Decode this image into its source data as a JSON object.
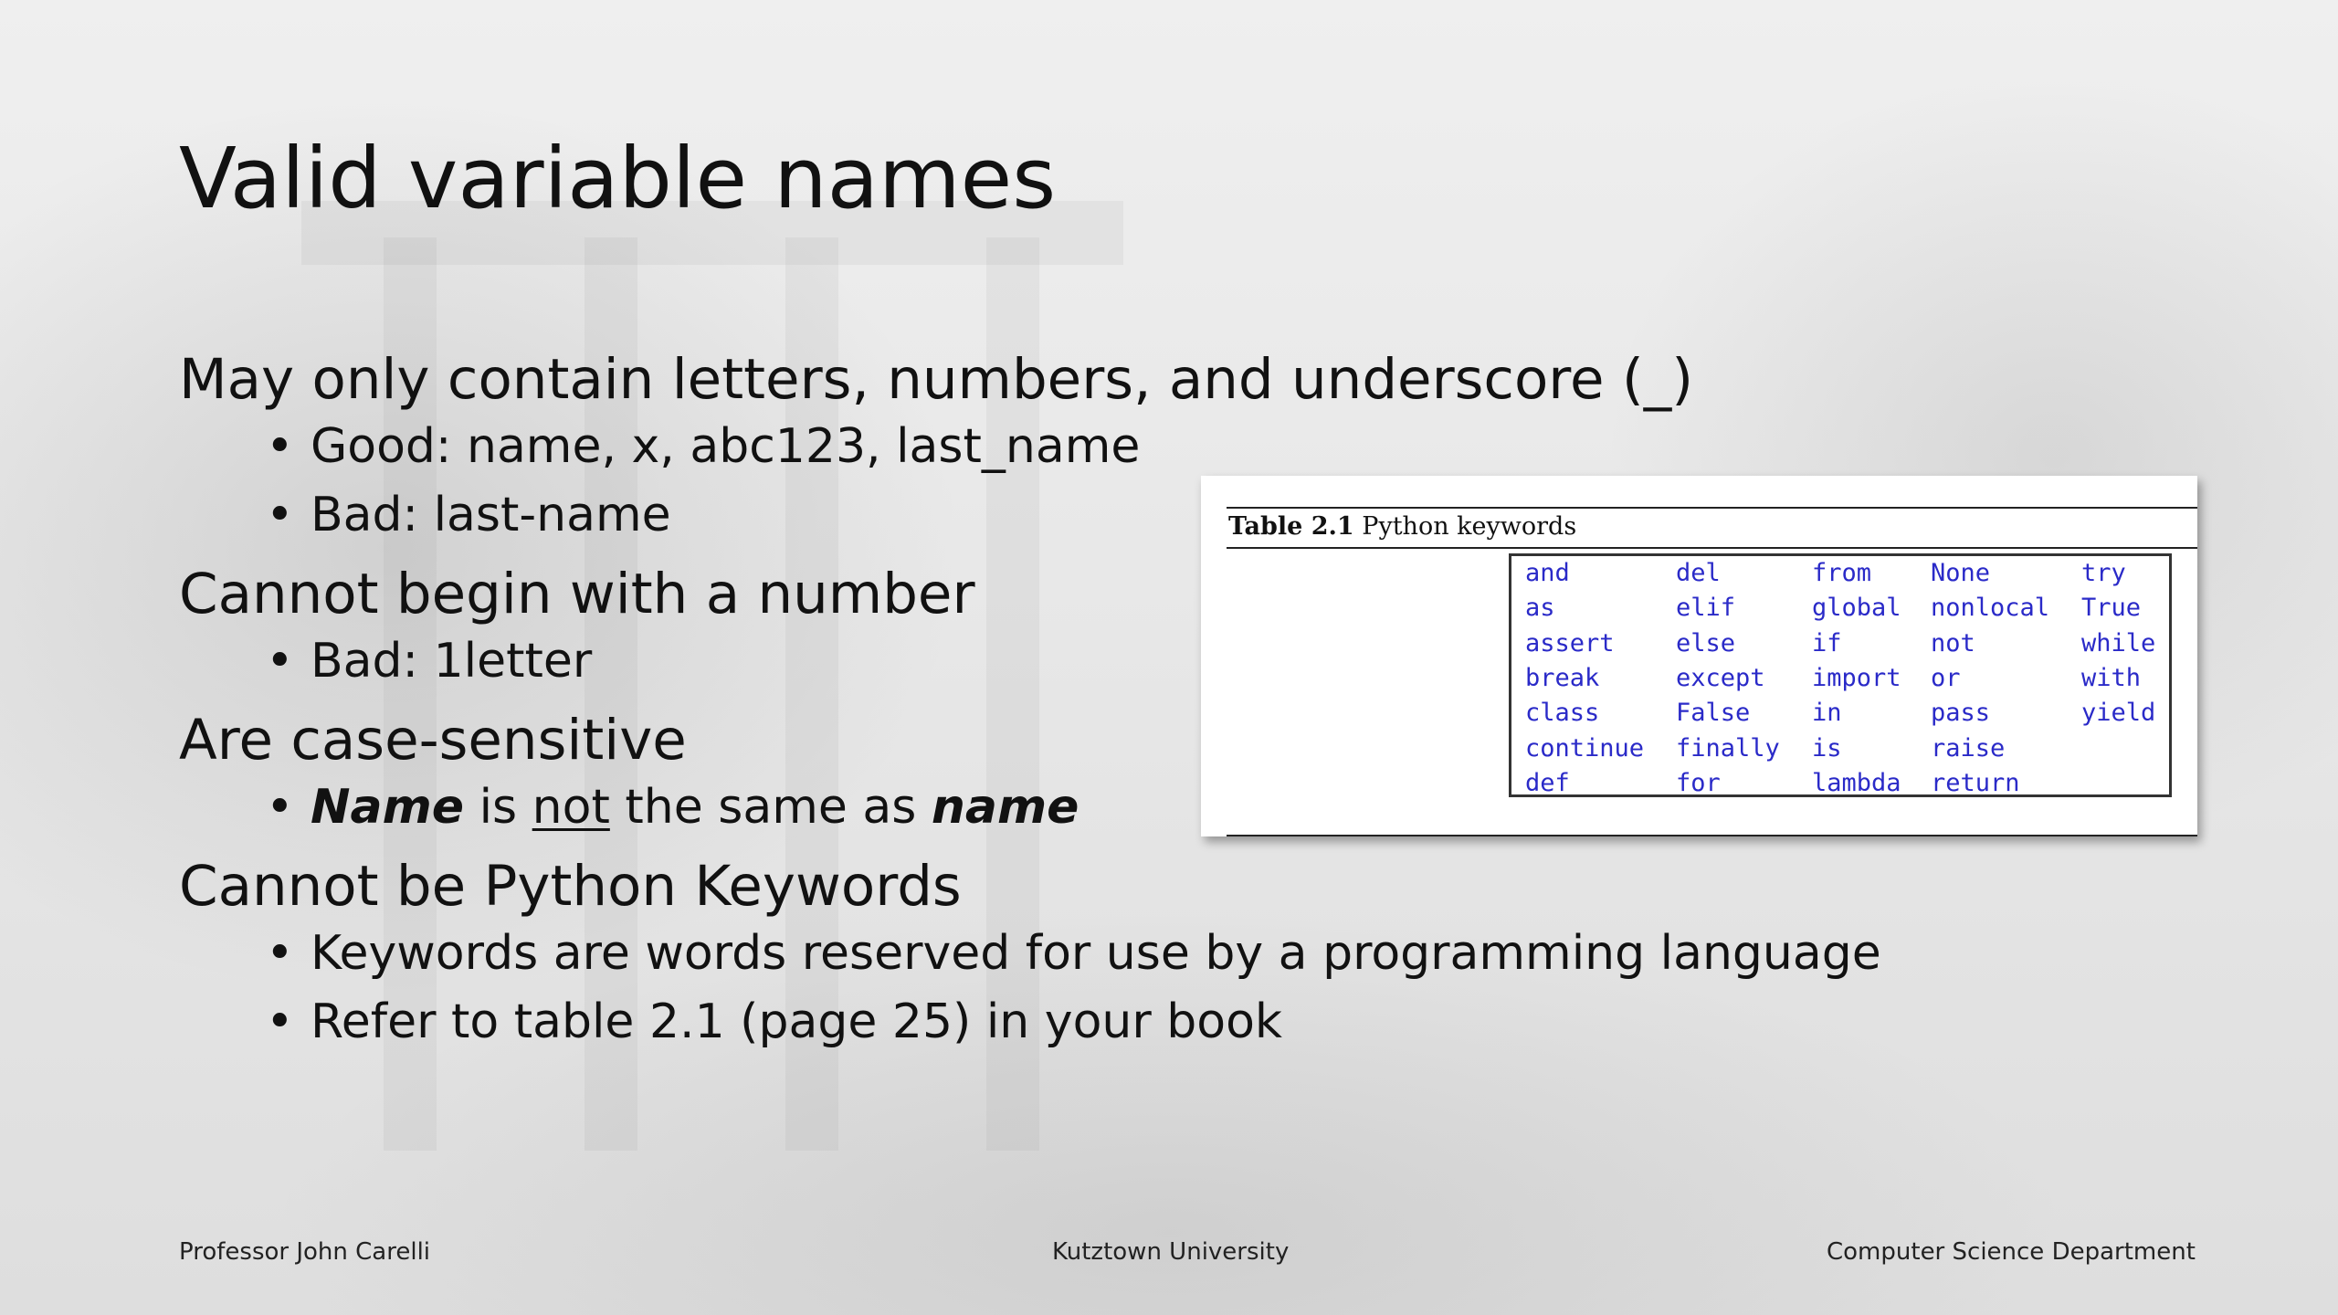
{
  "slide": {
    "title": "Valid variable names",
    "points": [
      {
        "text": "May only contain letters, numbers, and underscore (_)",
        "subs": [
          "Good: name, x, abc123, last_name",
          "Bad: last-name"
        ]
      },
      {
        "text": "Cannot begin with a number",
        "subs": [
          "Bad: 1letter"
        ]
      },
      {
        "text": "Are case-sensitive",
        "rich_sub": {
          "w1": "Name",
          "w2": " is ",
          "w3": "not",
          "w4": " the same as ",
          "w5": "name"
        }
      },
      {
        "text": "Cannot be Python Keywords",
        "subs": [
          "Keywords are words reserved for use by a programming language",
          "Refer to table 2.1 (page 25) in your book"
        ]
      }
    ],
    "bullet_glyph": "•"
  },
  "figure": {
    "caption_number": "Table 2.1",
    "caption_text": " Python keywords",
    "keyword_color": "#2a2ac8",
    "columns": [
      [
        "and",
        "as",
        "assert",
        "break",
        "class",
        "continue",
        "def"
      ],
      [
        "del",
        "elif",
        "else",
        "except",
        "False",
        "finally",
        "for"
      ],
      [
        "from",
        "global",
        "if",
        "import",
        "in",
        "is",
        "lambda"
      ],
      [
        "None",
        "nonlocal",
        "not",
        "or",
        "pass",
        "raise",
        "return"
      ],
      [
        "try",
        "True",
        "while",
        "with",
        "yield"
      ]
    ]
  },
  "footer": {
    "left": "Professor John Carelli",
    "center": "Kutztown University",
    "right": "Computer Science Department"
  }
}
